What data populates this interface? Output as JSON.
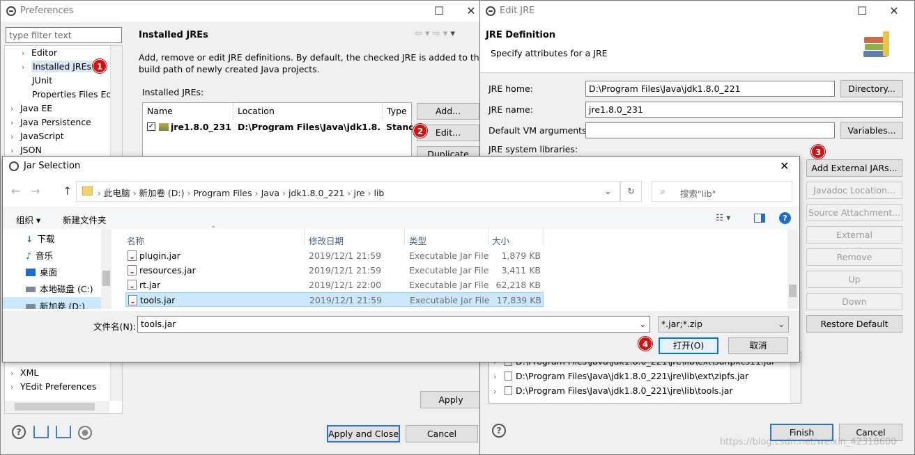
{
  "preferences": {
    "title": "Preferences",
    "filter_placeholder": "type filter text",
    "tree": [
      "Editor",
      "Installed JREs",
      "JUnit",
      "Properties Files Edi",
      "Java EE",
      "Java Persistence",
      "JavaScript",
      "JSON",
      "XML",
      "YEdit Preferences"
    ],
    "page_title": "Installed JREs",
    "description": "Add, remove or edit JRE definitions. By default, the checked JRE is added to the build path of newly created Java projects.",
    "description_line1": "Add, remove or edit JRE definitions. By default, the checked JRE is added to the",
    "description_line2": "build path of newly created Java projects.",
    "installed_label": "Installed JREs:",
    "table_headers": [
      "Name",
      "Location",
      "Type"
    ],
    "jre_row": {
      "name": "jre1.8.0_231 ...",
      "location": "D:\\Program Files\\Java\\jdk1.8.0...",
      "type": "Stand"
    },
    "buttons": {
      "add": "Add...",
      "edit": "Edit...",
      "duplicate": "Duplicate",
      "apply": "Apply",
      "apply_close": "Apply and Close",
      "cancel": "Cancel"
    }
  },
  "edit_jre": {
    "title": "Edit JRE",
    "heading": "JRE Definition",
    "subheading": "Specify attributes for a JRE",
    "jre_home_label": "JRE home:",
    "jre_home_value": "D:\\Program Files\\Java\\jdk1.8.0_221",
    "jre_name_label": "JRE name:",
    "jre_name_value": "jre1.8.0_231",
    "vm_args_label": "Default VM arguments:",
    "vm_args_value": "",
    "libs_label": "JRE system libraries:",
    "libraries": [
      "D:\\Program Files\\Java\\jdk1.8.0_221\\jre\\lib\\ext\\sunpkcs11.jar",
      "D:\\Program Files\\Java\\jdk1.8.0_221\\jre\\lib\\ext\\zipfs.jar",
      "D:\\Program Files\\Java\\jdk1.8.0_221\\jre\\lib\\tools.jar"
    ],
    "buttons": {
      "directory": "Directory...",
      "variables": "Variables...",
      "add_external": "Add External JARs...",
      "javadoc": "Javadoc Location...",
      "source": "Source Attachment...",
      "external_annotations": "External annotations...",
      "remove": "Remove",
      "up": "Up",
      "down": "Down",
      "restore": "Restore Default",
      "finish": "Finish",
      "cancel": "Cancel"
    }
  },
  "jar_selection": {
    "title": "Jar Selection",
    "breadcrumb": [
      "此电脑",
      "新加卷 (D:)",
      "Program Files",
      "Java",
      "jdk1.8.0_221",
      "jre",
      "lib"
    ],
    "search_placeholder": "搜索\"lib\"",
    "organize": "组织 ▾",
    "new_folder": "新建文件夹",
    "nav_items": [
      "下载",
      "音乐",
      "桌面",
      "本地磁盘 (C:)",
      "新加卷 (D:)"
    ],
    "columns": [
      "名称",
      "修改日期",
      "类型",
      "大小"
    ],
    "files": [
      {
        "name": "plugin.jar",
        "date": "2019/12/1 21:59",
        "type": "Executable Jar File",
        "size": "1,879 KB"
      },
      {
        "name": "resources.jar",
        "date": "2019/12/1 21:59",
        "type": "Executable Jar File",
        "size": "3,411 KB"
      },
      {
        "name": "rt.jar",
        "date": "2019/12/1 22:00",
        "type": "Executable Jar File",
        "size": "62,218 KB"
      },
      {
        "name": "tools.jar",
        "date": "2019/12/1 21:59",
        "type": "Executable Jar File",
        "size": "17,839 KB"
      }
    ],
    "filename_label": "文件名(N):",
    "filename_value": "tools.jar",
    "filter_value": "*.jar;*.zip",
    "open": "打开(O)",
    "cancel": "取消"
  },
  "badges": [
    "1",
    "2",
    "3",
    "4"
  ],
  "watermark": "https://blog.csdn.net/weixin_42318600"
}
